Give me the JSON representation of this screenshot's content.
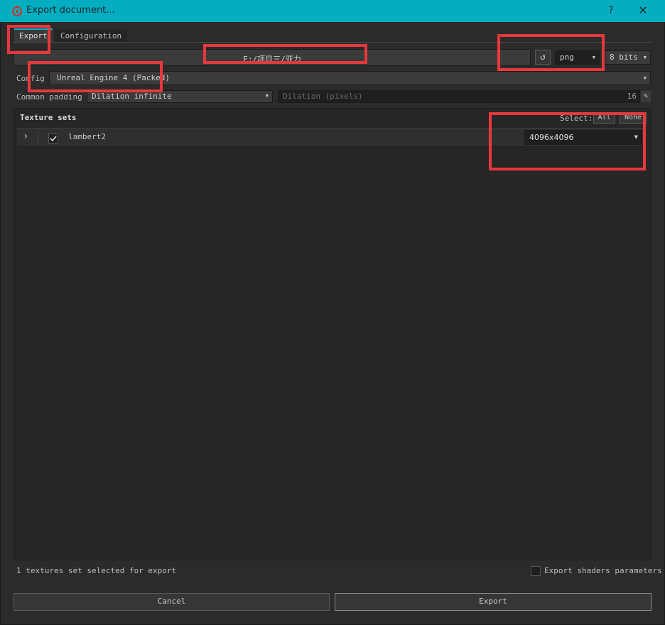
{
  "window": {
    "title": "Export document...",
    "help_label": "?",
    "close_label": "✕"
  },
  "tabs": [
    {
      "label": "Export",
      "active": true
    },
    {
      "label": "Configuration",
      "active": false
    }
  ],
  "output": {
    "path": "E:/项目三/亚力",
    "format": "png",
    "bit_depth": "8 bits"
  },
  "config": {
    "label": "Config",
    "value": "Unreal Engine 4 (Packed)"
  },
  "padding": {
    "label": "Common padding",
    "value": "Dilation infinite",
    "dilation_placeholder": "Dilation (pixels)",
    "dilation_value": "16"
  },
  "texture_sets": {
    "heading": "Texture sets",
    "select_label": "Select:",
    "all_label": "All",
    "none_label": "None",
    "items": [
      {
        "name": "lambert2",
        "checked": true,
        "resolution": "4096x4096"
      }
    ]
  },
  "footer": {
    "status": "1 textures set selected for export",
    "shaders_label": "Export shaders parameters",
    "shaders_checked": false,
    "cancel_label": "Cancel",
    "export_label": "Export"
  },
  "colors": {
    "titlebar": "#04aec0",
    "accent": "#1ea9c9",
    "highlight_box": "#e8383d"
  }
}
